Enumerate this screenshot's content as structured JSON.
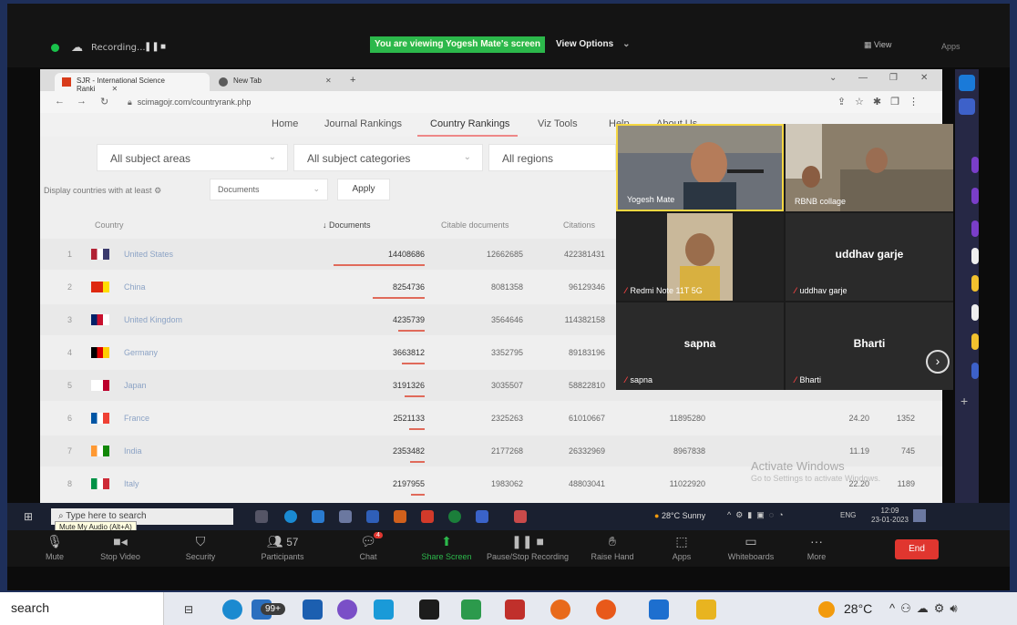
{
  "zoom": {
    "recording_label": "Recording...",
    "pause_glyph": "❚❚",
    "stop_glyph": "■",
    "viewing_banner": "You are viewing Yogesh Mate's screen",
    "view_options": "View Options",
    "view_label": "View",
    "apps_label": "Apps"
  },
  "browser": {
    "tabs": [
      {
        "label": "SJR - International Science Ranki"
      },
      {
        "label": "New Tab"
      }
    ],
    "url": "scimagojr.com/countryrank.php",
    "nav": [
      "Home",
      "Journal Rankings",
      "Country Rankings",
      "Viz Tools",
      "Help",
      "About Us"
    ],
    "filters": {
      "subject_areas": "All subject areas",
      "subject_categories": "All subject categories",
      "regions": "All regions"
    },
    "display_label": "Display countries with at least",
    "docs_select": "Documents",
    "apply": "Apply",
    "headers": {
      "country": "Country",
      "documents": "Documents",
      "citable": "Citable documents",
      "citations": "Citations"
    },
    "rows": [
      {
        "rank": "1",
        "country": "United States",
        "documents": "14408686",
        "citable": "12662685",
        "citations": "422381431",
        "cites": "",
        "h": "",
        "idx": ""
      },
      {
        "rank": "2",
        "country": "China",
        "documents": "8254736",
        "citable": "8081358",
        "citations": "96129346",
        "cites": "",
        "h": "",
        "idx": ""
      },
      {
        "rank": "3",
        "country": "United Kingdom",
        "documents": "4235739",
        "citable": "3564646",
        "citations": "114382158",
        "cites": "",
        "h": "",
        "idx": ""
      },
      {
        "rank": "4",
        "country": "Germany",
        "documents": "3663812",
        "citable": "3352795",
        "citations": "89183196",
        "cites": "",
        "h": "",
        "idx": ""
      },
      {
        "rank": "5",
        "country": "Japan",
        "documents": "3191326",
        "citable": "3035507",
        "citations": "58822810",
        "cites": "",
        "h": "",
        "idx": ""
      },
      {
        "rank": "6",
        "country": "France",
        "documents": "2521133",
        "citable": "2325263",
        "citations": "61010667",
        "cites": "11895280",
        "h": "24.20",
        "idx": "1352"
      },
      {
        "rank": "7",
        "country": "India",
        "documents": "2353482",
        "citable": "2177268",
        "citations": "26332969",
        "cites": "8967838",
        "h": "11.19",
        "idx": "745"
      },
      {
        "rank": "8",
        "country": "Italy",
        "documents": "2197955",
        "citable": "1983062",
        "citations": "48803041",
        "cites": "11022920",
        "h": "22.20",
        "idx": "1189"
      }
    ],
    "watermark_title": "Activate Windows",
    "watermark_sub": "Go to Settings to activate Windows."
  },
  "gallery": {
    "yogesh": "Yogesh Mate",
    "rbne": "RBNB collage",
    "redmi": "Redmi Note 11T 5G",
    "uddhav_big": "uddhav garje",
    "uddhav": "uddhav garje",
    "sapna_big": "sapna",
    "sapna": "sapna",
    "bharti_big": "Bharti",
    "bharti": "Bharti"
  },
  "proj_taskbar": {
    "search_placeholder": "Type here to search",
    "tooltip": "Mute My Audio (Alt+A)",
    "weather": "28°C Sunny",
    "lang": "ENG",
    "time": "12:09",
    "date": "23-01-2023"
  },
  "controls": {
    "mute": "Mute",
    "stop_video": "Stop Video",
    "security": "Security",
    "participants": "Participants",
    "participants_count": "57",
    "chat": "Chat",
    "chat_badge": "4",
    "share": "Share Screen",
    "pause_rec": "Pause/Stop Recording",
    "raise_hand": "Raise Hand",
    "apps": "Apps",
    "whiteboards": "Whiteboards",
    "more": "More",
    "end": "End"
  },
  "win_taskbar": {
    "search": "search",
    "badge": "99+",
    "temp": "28°C"
  }
}
